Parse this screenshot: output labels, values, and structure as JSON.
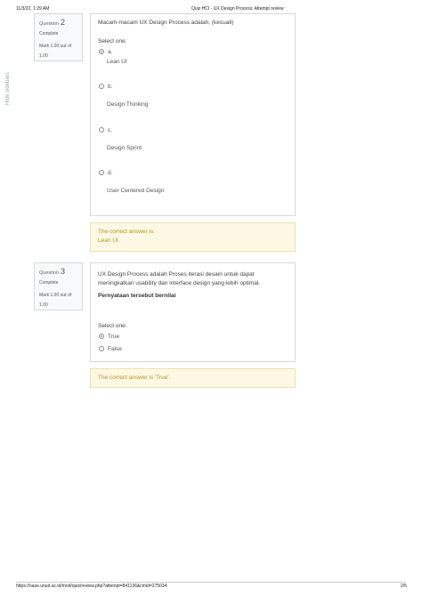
{
  "print_header": {
    "datetime": "11/3/22, 1:29 AM",
    "title": "Quiz HCI - UX Design Process: Attempt review"
  },
  "sidebar": {
    "label": "Hide sidebars"
  },
  "questions": [
    {
      "label": "Question",
      "number": "2",
      "state": "Complete",
      "grade_line1": "Mark 1.00 out of",
      "grade_line2": "1.00",
      "text": "Macam-macam UX Design Process adalah, (kecuali)",
      "select_one": "Select one:",
      "options": [
        {
          "letter": "a.",
          "text": "Lean UI",
          "checked": true
        },
        {
          "letter": "b.",
          "text": "Design Thinking",
          "checked": false
        },
        {
          "letter": "c.",
          "text": "Design Sprint",
          "checked": false
        },
        {
          "letter": "d.",
          "text": "User Centered Design",
          "checked": false
        }
      ],
      "feedback_line1": "The correct answer is:",
      "feedback_line2": "Lean UI"
    },
    {
      "label": "Question",
      "number": "3",
      "state": "Complete",
      "grade_line1": "Mark 1.00 out of",
      "grade_line2": "1.00",
      "text": "UX Design Process adalah Proses iterasi desain untuk dapat  meningkatkan usability dan interface  design yang lebih optimal.",
      "statement": "Pernyataan tersebut bernilai",
      "select_one": "Select one:",
      "options": [
        {
          "text": "True",
          "checked": true
        },
        {
          "text": "False",
          "checked": false
        }
      ],
      "feedback_line1": "The correct answer is 'True'."
    }
  ],
  "footer": {
    "url": "https://oase.unud.ac.id/mod/quiz/review.php?attempt=841136&cmid=275034",
    "page": "2/5"
  }
}
